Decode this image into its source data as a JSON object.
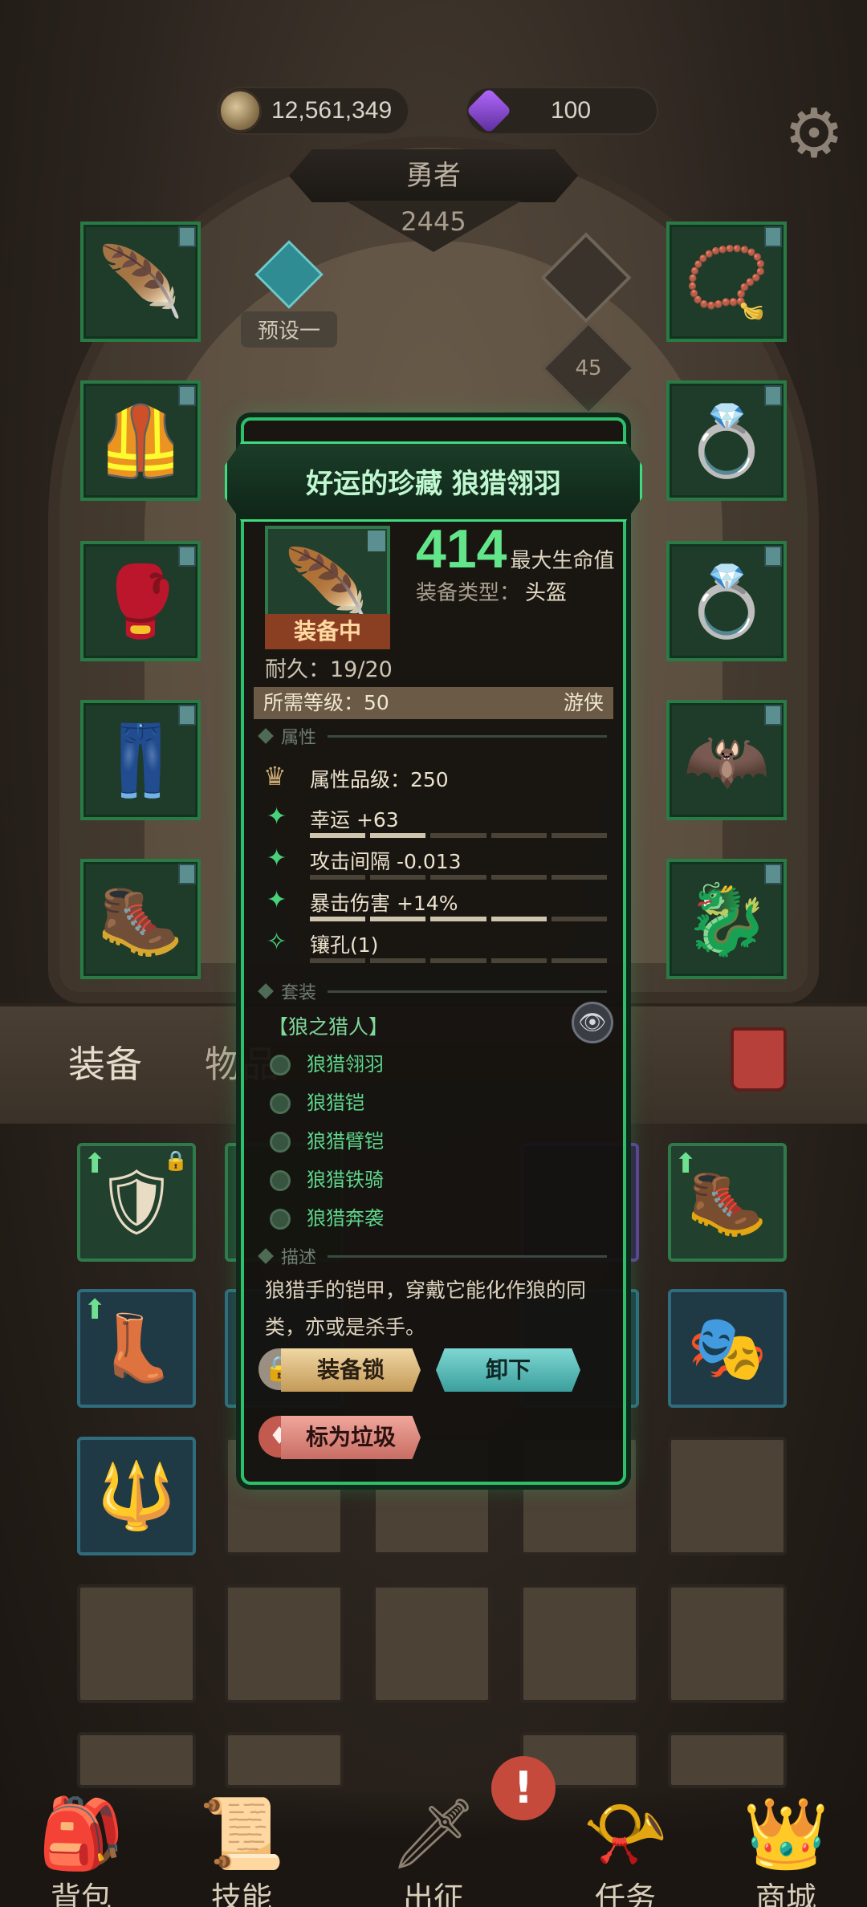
{
  "currency": {
    "gold": "12,561,349",
    "gems": "100"
  },
  "hero": {
    "name": "勇者",
    "power": "2445",
    "preset_label": "预设一",
    "level": "45"
  },
  "equipment_slots_left": [
    {
      "icon": "feather-icon",
      "glyph": "🪶"
    },
    {
      "icon": "shoulder-armor-icon",
      "glyph": "🦺"
    },
    {
      "icon": "gauntlet-icon",
      "glyph": "🥊"
    },
    {
      "icon": "pants-icon",
      "glyph": "👖"
    },
    {
      "icon": "boots-icon",
      "glyph": "🥾"
    }
  ],
  "equipment_slots_right": [
    {
      "icon": "necklace-icon",
      "glyph": "📿"
    },
    {
      "icon": "ring-icon",
      "glyph": "💍"
    },
    {
      "icon": "ring-blue-icon",
      "glyph": "💍"
    },
    {
      "icon": "wing-icon",
      "glyph": "🦇"
    },
    {
      "icon": "skull-trinket-icon",
      "glyph": "🐉"
    }
  ],
  "tabs": {
    "equipment": "装备",
    "items": "物品"
  },
  "inventory": [
    {
      "style": "green",
      "glyph": "🛡",
      "up": true,
      "lock": true
    },
    {
      "style": "green",
      "glyph": "",
      "up": true,
      "lock": false
    },
    {
      "style": "purple",
      "glyph": "",
      "up": false,
      "lock": false
    },
    {
      "style": "green",
      "glyph": "🥾",
      "up": true,
      "lock": false
    },
    {
      "style": "blue",
      "glyph": "👢",
      "up": true,
      "lock": false
    },
    {
      "style": "blue",
      "glyph": "",
      "up": false,
      "lock": false
    },
    {
      "style": "blue",
      "glyph": "",
      "up": false,
      "lock": false
    },
    {
      "style": "blue",
      "glyph": "🎭",
      "up": false,
      "lock": false
    },
    {
      "style": "blue",
      "glyph": "🔱",
      "up": false,
      "lock": false
    }
  ],
  "popup": {
    "title": "好运的珍藏 狼猎翎羽",
    "equipped_badge": "装备中",
    "main_value": "414",
    "main_label": "最大生命值",
    "type_label": "装备类型：",
    "type_value": "头盔",
    "durability": "耐久：19/20",
    "required_level": "所需等级：50",
    "class": "游侠",
    "section_attributes": "属性",
    "quality": "属性品级：250",
    "stats": [
      {
        "text": "幸运 +63",
        "fill": 0.35
      },
      {
        "text": "攻击间隔 -0.013",
        "fill": 0.0
      },
      {
        "text": "暴击伤害 +14%",
        "fill": 0.85
      },
      {
        "text": "镶孔(1)",
        "fill": 0.0
      }
    ],
    "section_set": "套装",
    "set_name": "【狼之猎人】",
    "set_items": [
      "狼猎翎羽",
      "狼猎铠",
      "狼猎臂铠",
      "狼猎铁骑",
      "狼猎奔袭"
    ],
    "section_desc": "描述",
    "description": "狼猎手的铠甲，穿戴它能化作狼的同类，亦或是杀手。",
    "btn_lock": "装备锁",
    "btn_unequip": "卸下",
    "btn_junk": "标为垃圾"
  },
  "nav": [
    {
      "label": "背包",
      "glyph": "🎒"
    },
    {
      "label": "技能",
      "glyph": "📜"
    },
    {
      "label": "出征",
      "glyph": "🗡"
    },
    {
      "label": "任务",
      "glyph": "📯"
    },
    {
      "label": "商城",
      "glyph": "👑"
    }
  ],
  "colors": {
    "accent_green": "#2fbf6a",
    "stat_green": "#63e58a",
    "unequip_teal": "#3c9f9d",
    "equipped_orange": "#8b3f22"
  }
}
